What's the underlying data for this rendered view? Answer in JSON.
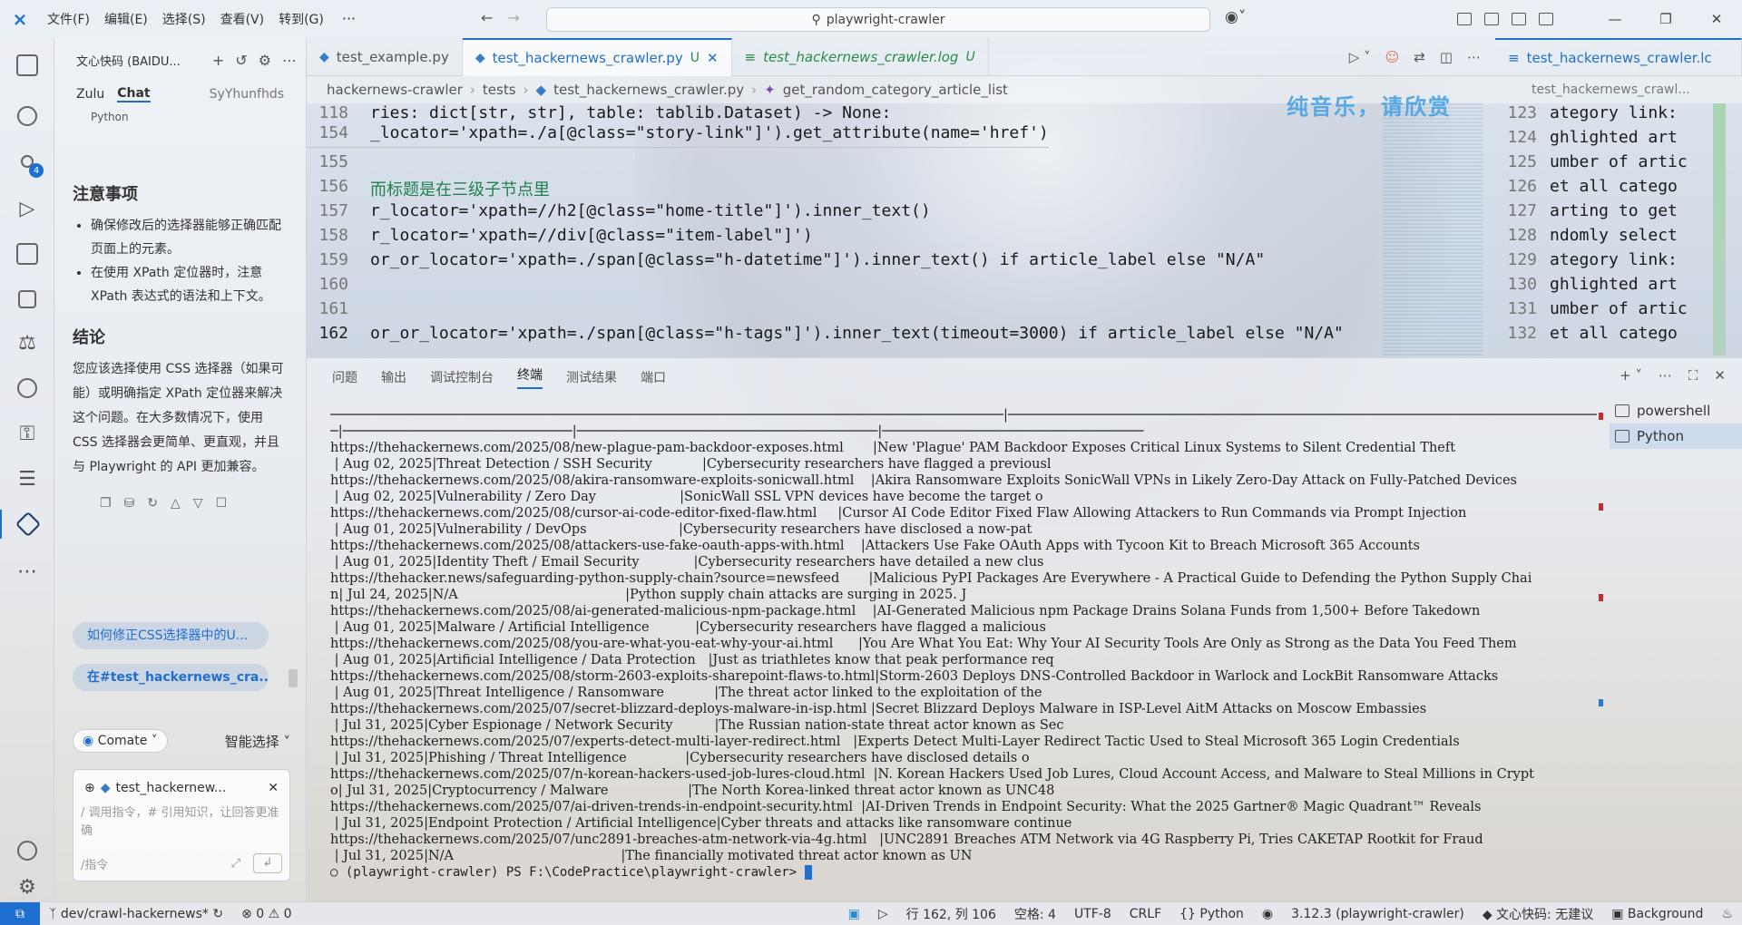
{
  "titlebar": {
    "menu": [
      "文件(F)",
      "编辑(E)",
      "选择(S)",
      "查看(V)",
      "转到(G)"
    ],
    "more": "···",
    "search": "playwright-crawler"
  },
  "chat": {
    "header_title": "文心快码 (BAIDU...",
    "tabs": [
      "Zulu",
      "Chat"
    ],
    "user": "SyYhunfhds",
    "python_chip": "Python",
    "notes_title": "注意事项",
    "notes": [
      "确保修改后的选择器能够正确匹配页面上的元素。",
      "在使用 XPath 定位器时，注意 XPath 表达式的语法和上下文。"
    ],
    "conclusion_title": "结论",
    "conclusion_text": "您应该选择使用 CSS 选择器（如果可能）或明确指定 XPath 定位器来解决这个问题。在大多数情况下，使用 CSS 选择器会更简单、更直观，并且与 Playwright 的 API 更加兼容。",
    "suggestions": [
      "如何修正CSS选择器中的U...",
      "在#test_hackernews_cra..."
    ],
    "comate_label": "Comate",
    "smart_select": "智能选择",
    "file_chip": "test_hackernew...",
    "input_placeholder": "/ 调用指令，# 引用知识，让回答更准确",
    "input_hint": "/指令"
  },
  "editor": {
    "tabs": [
      {
        "label": "test_example.py",
        "modified": ""
      },
      {
        "label": "test_hackernews_crawler.py",
        "modified": "U"
      },
      {
        "label": "test_hackernews_crawler.log",
        "modified": "U"
      }
    ],
    "right_tab": "test_hackernews_crawler.lc",
    "breadcrumb": [
      "hackernews-crawler",
      "tests",
      "test_hackernews_crawler.py",
      "get_random_category_article_list"
    ],
    "breadcrumb_right": "test_hackernews_crawl...",
    "overlay_text": "纯音乐，请欣赏",
    "code_lines": [
      {
        "n": "118",
        "text": "ries: dict[str, str], table: tablib.Dataset) -> None:"
      },
      {
        "n": "154",
        "text": "_locator='xpath=./a[@class=\"story-link\"]').get_attribute(name='href')"
      },
      {
        "n": "155",
        "text": ""
      },
      {
        "n": "156",
        "text": "而标题是在三级子节点里"
      },
      {
        "n": "157",
        "text": "r_locator='xpath=//h2[@class=\"home-title\"]').inner_text()"
      },
      {
        "n": "158",
        "text": "r_locator='xpath=//div[@class=\"item-label\"]')"
      },
      {
        "n": "159",
        "text": "or_or_locator='xpath=./span[@class=\"h-datetime\"]').inner_text() if article_label else \"N/A\""
      },
      {
        "n": "160",
        "text": ""
      },
      {
        "n": "161",
        "text": ""
      },
      {
        "n": "162",
        "text": "or_or_locator='xpath=./span[@class=\"h-tags\"]').inner_text(timeout=3000) if article_label else \"N/A\""
      }
    ],
    "right_lines": [
      {
        "n": "123",
        "text": "ategory link: "
      },
      {
        "n": "124",
        "text": "ghlighted art"
      },
      {
        "n": "125",
        "text": "umber of artic"
      },
      {
        "n": "126",
        "text": "et all catego"
      },
      {
        "n": "127",
        "text": "arting to get"
      },
      {
        "n": "128",
        "text": "ndomly select"
      },
      {
        "n": "129",
        "text": "ategory link: "
      },
      {
        "n": "130",
        "text": "ghlighted art"
      },
      {
        "n": "131",
        "text": "umber of artic"
      },
      {
        "n": "132",
        "text": "et all catego"
      }
    ]
  },
  "panel": {
    "tabs": [
      "问题",
      "输出",
      "调试控制台",
      "终端",
      "测试结果",
      "端口"
    ],
    "terminals": [
      "powershell",
      "Python"
    ],
    "lines": [
      "─────────────────────────────────────────────────────────────────────────────────────|───────────────────────────────────────────────────────────────────────────────────────",
      "─|─────────────────────────────|──────────────────────────────────────|─────────────────────────────────",
      "https://thehackernews.com/2025/08/new-plague-pam-backdoor-exposes.html       |New 'Plague' PAM Backdoor Exposes Critical Linux Systems to Silent Credential Theft",
      " | Aug 02, 2025|Threat Detection / SSH Security            |Cybersecurity researchers have flagged a previousl",
      "https://thehackernews.com/2025/08/akira-ransomware-exploits-sonicwall.html    |Akira Ransomware Exploits SonicWall VPNs in Likely Zero-Day Attack on Fully-Patched Devices",
      " | Aug 02, 2025|Vulnerability / Zero Day                    |SonicWall SSL VPN devices have become the target o",
      "https://thehackernews.com/2025/08/cursor-ai-code-editor-fixed-flaw.html     |Cursor AI Code Editor Fixed Flaw Allowing Attackers to Run Commands via Prompt Injection",
      " | Aug 01, 2025|Vulnerability / DevOps                      |Cybersecurity researchers have disclosed a now-pat",
      "https://thehackernews.com/2025/08/attackers-use-fake-oauth-apps-with.html    |Attackers Use Fake OAuth Apps with Tycoon Kit to Breach Microsoft 365 Accounts",
      " | Aug 01, 2025|Identity Theft / Email Security             |Cybersecurity researchers have detailed a new clus",
      "https://thehacker.news/safeguarding-python-supply-chain?source=newsfeed       |Malicious PyPI Packages Are Everywhere - A Practical Guide to Defending the Python Supply Chai",
      "n| Jul 24, 2025|N/A                                        |Python supply chain attacks are surging in 2025. J",
      "https://thehackernews.com/2025/08/ai-generated-malicious-npm-package.html    |AI-Generated Malicious npm Package Drains Solana Funds from 1,500+ Before Takedown",
      " | Aug 01, 2025|Malware / Artificial Intelligence           |Cybersecurity researchers have flagged a malicious",
      "https://thehackernews.com/2025/08/you-are-what-you-eat-why-your-ai.html      |You Are What You Eat: Why Your AI Security Tools Are Only as Strong as the Data You Feed Them",
      " | Aug 01, 2025|Artificial Intelligence / Data Protection   |Just as triathletes know that peak performance req",
      "https://thehackernews.com/2025/08/storm-2603-exploits-sharepoint-flaws-to.html|Storm-2603 Deploys DNS-Controlled Backdoor in Warlock and LockBit Ransomware Attacks",
      " | Aug 01, 2025|Threat Intelligence / Ransomware            |The threat actor linked to the exploitation of the",
      "https://thehackernews.com/2025/07/secret-blizzard-deploys-malware-in-isp.html |Secret Blizzard Deploys Malware in ISP-Level AitM Attacks on Moscow Embassies",
      " | Jul 31, 2025|Cyber Espionage / Network Security          |The Russian nation-state threat actor known as Sec",
      "https://thehackernews.com/2025/07/experts-detect-multi-layer-redirect.html   |Experts Detect Multi-Layer Redirect Tactic Used to Steal Microsoft 365 Login Credentials",
      " | Jul 31, 2025|Phishing / Threat Intelligence              |Cybersecurity researchers have disclosed details o",
      "https://thehackernews.com/2025/07/n-korean-hackers-used-job-lures-cloud.html  |N. Korean Hackers Used Job Lures, Cloud Account Access, and Malware to Steal Millions in Crypt",
      "o| Jul 31, 2025|Cryptocurrency / Malware                   |The North Korea-linked threat actor known as UNC48",
      "https://thehackernews.com/2025/07/ai-driven-trends-in-endpoint-security.html  |AI-Driven Trends in Endpoint Security: What the 2025 Gartner® Magic Quadrant™ Reveals",
      " | Jul 31, 2025|Endpoint Protection / Artificial Intelligence|Cyber threats and attacks like ransomware continue",
      "https://thehackernews.com/2025/07/unc2891-breaches-atm-network-via-4g.html   |UNC2891 Breaches ATM Network via 4G Raspberry Pi, Tries CAKETAP Rootkit for Fraud",
      " | Jul 31, 2025|N/A                                        |The financially motivated threat actor known as UN"
    ],
    "prompt": "(playwright-crawler) PS F:\\CodePractice\\playwright-crawler> "
  },
  "status": {
    "branch": "dev/crawl-hackernews*",
    "errors": "0",
    "warnings": "0",
    "position": "行 162, 列 106",
    "spaces": "空格: 4",
    "encoding": "UTF-8",
    "eol": "CRLF",
    "language": "Python",
    "interpreter": "3.12.3 (playwright-crawler)",
    "wenxin": "文心快码: 无建议",
    "background": "Background"
  }
}
